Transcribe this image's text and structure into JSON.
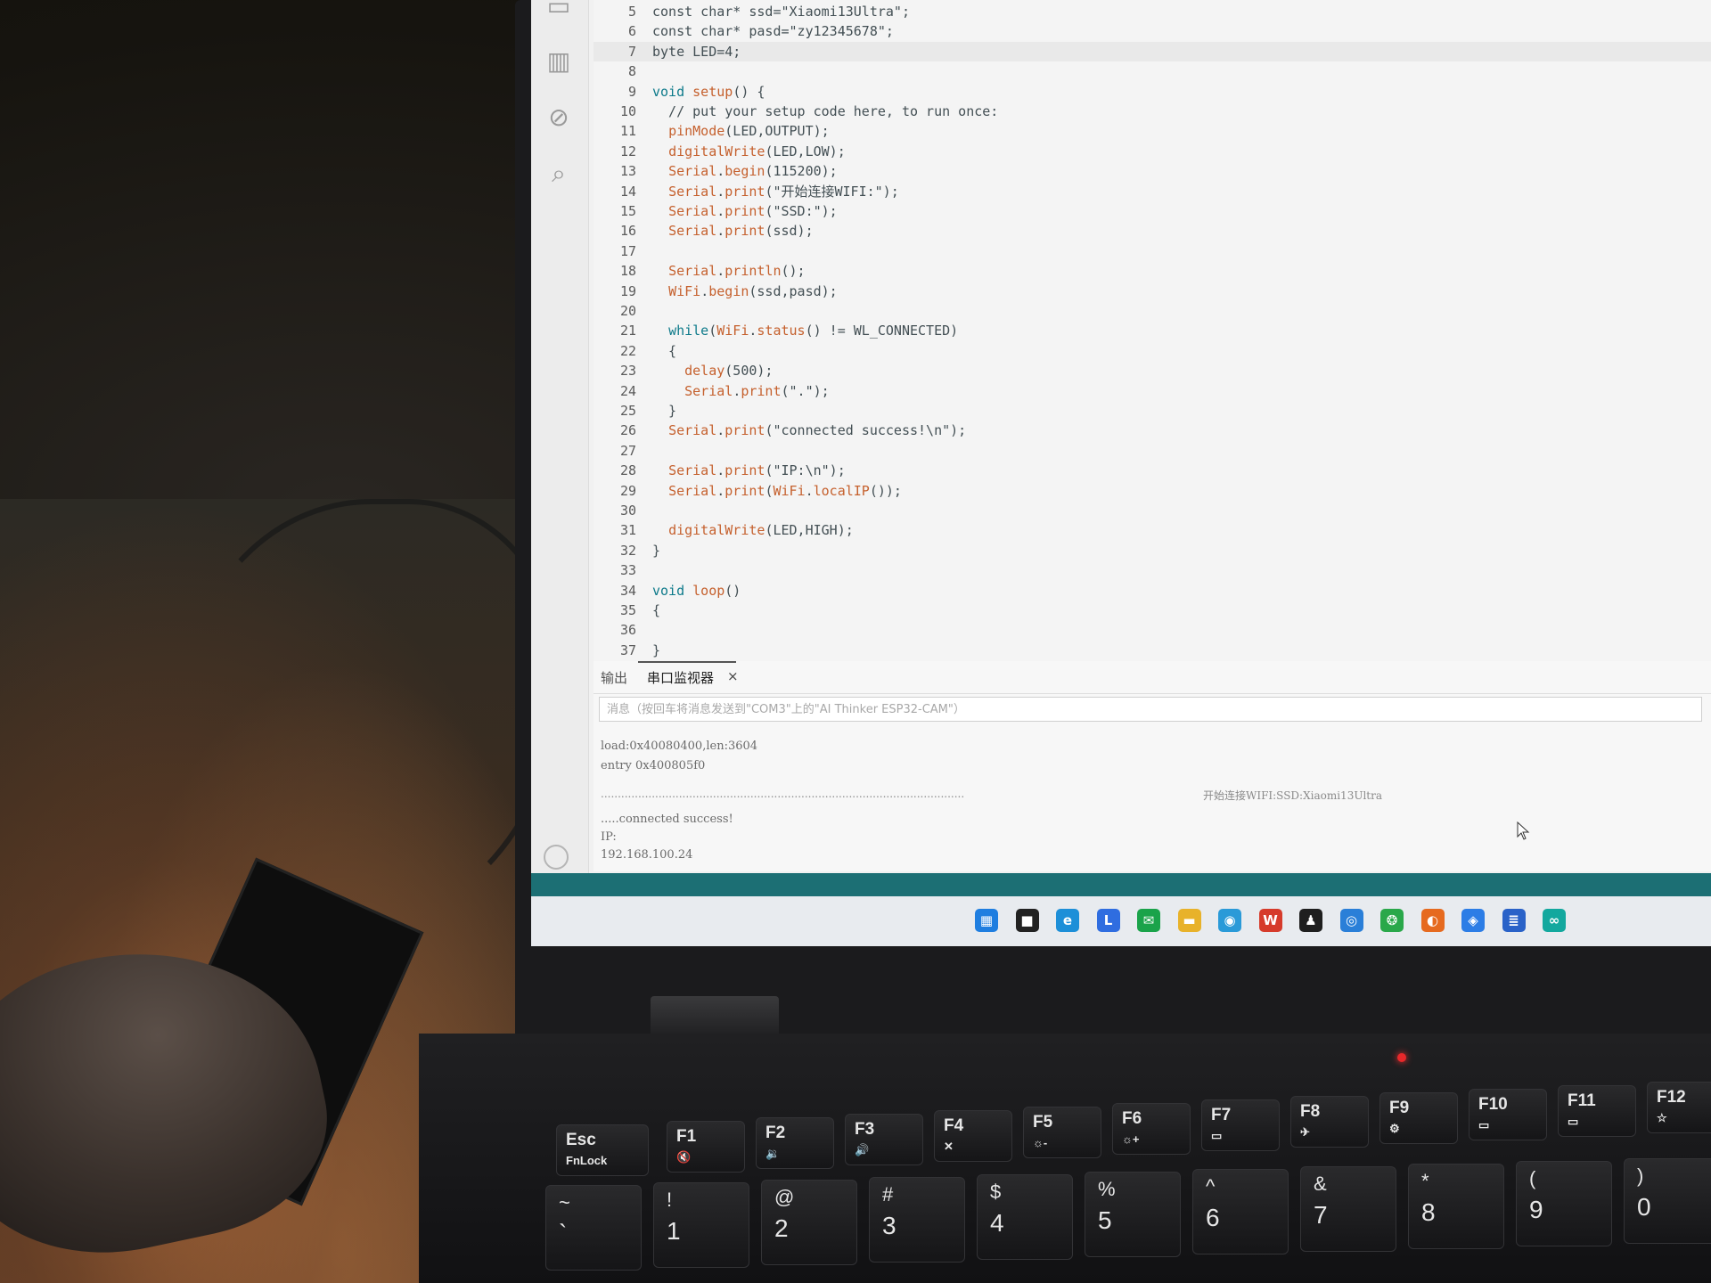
{
  "editor": {
    "current_line_index": 2,
    "lines": [
      {
        "num": "5",
        "segments": [
          {
            "t": "const char* ssd=\"Xiaomi13Ultra\";",
            "c": ""
          }
        ]
      },
      {
        "num": "6",
        "segments": [
          {
            "t": "const char* pasd=\"zy12345678\";",
            "c": ""
          }
        ]
      },
      {
        "num": "7",
        "segments": [
          {
            "t": "byte LED=4;",
            "c": ""
          }
        ]
      },
      {
        "num": "8",
        "segments": []
      },
      {
        "num": "9",
        "segments": [
          {
            "t": "void ",
            "c": "kw"
          },
          {
            "t": "setup",
            "c": "fn"
          },
          {
            "t": "() {",
            "c": ""
          }
        ]
      },
      {
        "num": "10",
        "segments": [
          {
            "t": "  // put your setup code here, to run once:",
            "c": ""
          }
        ]
      },
      {
        "num": "11",
        "segments": [
          {
            "t": "  ",
            "c": ""
          },
          {
            "t": "pinMode",
            "c": "fn"
          },
          {
            "t": "(LED,OUTPUT);",
            "c": ""
          }
        ]
      },
      {
        "num": "12",
        "segments": [
          {
            "t": "  ",
            "c": ""
          },
          {
            "t": "digitalWrite",
            "c": "fn"
          },
          {
            "t": "(LED,LOW);",
            "c": ""
          }
        ]
      },
      {
        "num": "13",
        "segments": [
          {
            "t": "  ",
            "c": ""
          },
          {
            "t": "Serial",
            "c": "fn"
          },
          {
            "t": ".",
            "c": ""
          },
          {
            "t": "begin",
            "c": "fn"
          },
          {
            "t": "(115200);",
            "c": ""
          }
        ]
      },
      {
        "num": "14",
        "segments": [
          {
            "t": "  ",
            "c": ""
          },
          {
            "t": "Serial",
            "c": "fn"
          },
          {
            "t": ".",
            "c": ""
          },
          {
            "t": "print",
            "c": "fn"
          },
          {
            "t": "(\"开始连接WIFI:\");",
            "c": ""
          }
        ]
      },
      {
        "num": "15",
        "segments": [
          {
            "t": "  ",
            "c": ""
          },
          {
            "t": "Serial",
            "c": "fn"
          },
          {
            "t": ".",
            "c": ""
          },
          {
            "t": "print",
            "c": "fn"
          },
          {
            "t": "(\"SSD:\");",
            "c": ""
          }
        ]
      },
      {
        "num": "16",
        "segments": [
          {
            "t": "  ",
            "c": ""
          },
          {
            "t": "Serial",
            "c": "fn"
          },
          {
            "t": ".",
            "c": ""
          },
          {
            "t": "print",
            "c": "fn"
          },
          {
            "t": "(ssd);",
            "c": ""
          }
        ]
      },
      {
        "num": "17",
        "segments": []
      },
      {
        "num": "18",
        "segments": [
          {
            "t": "  ",
            "c": ""
          },
          {
            "t": "Serial",
            "c": "fn"
          },
          {
            "t": ".",
            "c": ""
          },
          {
            "t": "println",
            "c": "fn"
          },
          {
            "t": "();",
            "c": ""
          }
        ]
      },
      {
        "num": "19",
        "segments": [
          {
            "t": "  ",
            "c": ""
          },
          {
            "t": "WiFi",
            "c": "fn"
          },
          {
            "t": ".",
            "c": ""
          },
          {
            "t": "begin",
            "c": "fn"
          },
          {
            "t": "(ssd,pasd);",
            "c": ""
          }
        ]
      },
      {
        "num": "20",
        "segments": []
      },
      {
        "num": "21",
        "segments": [
          {
            "t": "  ",
            "c": ""
          },
          {
            "t": "while",
            "c": "kw"
          },
          {
            "t": "(",
            "c": ""
          },
          {
            "t": "WiFi",
            "c": "fn"
          },
          {
            "t": ".",
            "c": ""
          },
          {
            "t": "status",
            "c": "fn"
          },
          {
            "t": "() != WL_CONNECTED)",
            "c": ""
          }
        ]
      },
      {
        "num": "22",
        "segments": [
          {
            "t": "  {",
            "c": ""
          }
        ]
      },
      {
        "num": "23",
        "segments": [
          {
            "t": "    ",
            "c": ""
          },
          {
            "t": "delay",
            "c": "fn"
          },
          {
            "t": "(500);",
            "c": ""
          }
        ]
      },
      {
        "num": "24",
        "segments": [
          {
            "t": "    ",
            "c": ""
          },
          {
            "t": "Serial",
            "c": "fn"
          },
          {
            "t": ".",
            "c": ""
          },
          {
            "t": "print",
            "c": "fn"
          },
          {
            "t": "(\".\");",
            "c": ""
          }
        ]
      },
      {
        "num": "25",
        "segments": [
          {
            "t": "  }",
            "c": ""
          }
        ]
      },
      {
        "num": "26",
        "segments": [
          {
            "t": "  ",
            "c": ""
          },
          {
            "t": "Serial",
            "c": "fn"
          },
          {
            "t": ".",
            "c": ""
          },
          {
            "t": "print",
            "c": "fn"
          },
          {
            "t": "(\"connected success!\\n\");",
            "c": ""
          }
        ]
      },
      {
        "num": "27",
        "segments": []
      },
      {
        "num": "28",
        "segments": [
          {
            "t": "  ",
            "c": ""
          },
          {
            "t": "Serial",
            "c": "fn"
          },
          {
            "t": ".",
            "c": ""
          },
          {
            "t": "print",
            "c": "fn"
          },
          {
            "t": "(\"IP:\\n\");",
            "c": ""
          }
        ]
      },
      {
        "num": "29",
        "segments": [
          {
            "t": "  ",
            "c": ""
          },
          {
            "t": "Serial",
            "c": "fn"
          },
          {
            "t": ".",
            "c": ""
          },
          {
            "t": "print",
            "c": "fn"
          },
          {
            "t": "(",
            "c": ""
          },
          {
            "t": "WiFi",
            "c": "fn"
          },
          {
            "t": ".",
            "c": ""
          },
          {
            "t": "localIP",
            "c": "fn"
          },
          {
            "t": "());",
            "c": ""
          }
        ]
      },
      {
        "num": "30",
        "segments": []
      },
      {
        "num": "31",
        "segments": [
          {
            "t": "  ",
            "c": ""
          },
          {
            "t": "digitalWrite",
            "c": "fn"
          },
          {
            "t": "(LED,HIGH);",
            "c": ""
          }
        ]
      },
      {
        "num": "32",
        "segments": [
          {
            "t": "}",
            "c": ""
          }
        ]
      },
      {
        "num": "33",
        "segments": []
      },
      {
        "num": "34",
        "segments": [
          {
            "t": "void ",
            "c": "kw"
          },
          {
            "t": "loop",
            "c": "fn"
          },
          {
            "t": "()",
            "c": ""
          }
        ]
      },
      {
        "num": "35",
        "segments": [
          {
            "t": "{",
            "c": ""
          }
        ]
      },
      {
        "num": "36",
        "segments": []
      },
      {
        "num": "37",
        "segments": [
          {
            "t": "}",
            "c": ""
          }
        ]
      }
    ]
  },
  "side_rail": {
    "icons": [
      "board-manager-icon",
      "library-icon",
      "debug-icon",
      "search-icon"
    ],
    "user_icon": "account-icon"
  },
  "panel": {
    "tab_output": "输出",
    "tab_serial": "串口监视器",
    "tab_close": "×",
    "message_placeholder": "消息（按回车将消息发送到\"COM3\"上的\"AI Thinker ESP32-CAM\"）",
    "serial_lines": {
      "load": "load:0x40080400,len:3604",
      "entry": "entry 0x400805f0",
      "dots": "...........................................................................................................",
      "wifi_tail": "开始连接WIFI:SSD:Xiaomi13Ultra",
      "connected": ".....connected success!",
      "ip_label": "IP:",
      "ip_value": "192.168.100.24"
    }
  },
  "taskbar": {
    "icons": [
      {
        "name": "windows-start-icon",
        "glyph": "▦",
        "color": "#1f7ee0"
      },
      {
        "name": "task-view-icon",
        "glyph": "■",
        "color": "#222222"
      },
      {
        "name": "edge-browser-icon",
        "glyph": "e",
        "color": "#1d8fd8"
      },
      {
        "name": "app-blue-icon",
        "glyph": "L",
        "color": "#2f6de0"
      },
      {
        "name": "wechat-mail-icon",
        "glyph": "✉",
        "color": "#1aa34a"
      },
      {
        "name": "file-explorer-icon",
        "glyph": "▬",
        "color": "#e8b22a"
      },
      {
        "name": "browser-icon",
        "glyph": "◉",
        "color": "#2a9ad8"
      },
      {
        "name": "wps-office-icon",
        "glyph": "W",
        "color": "#d63b2b"
      },
      {
        "name": "qq-icon",
        "glyph": "♟",
        "color": "#1f1f1f"
      },
      {
        "name": "search-app-icon",
        "glyph": "◎",
        "color": "#2a7fd8"
      },
      {
        "name": "wechat-icon",
        "glyph": "❂",
        "color": "#2aa84a"
      },
      {
        "name": "firefox-icon",
        "glyph": "◐",
        "color": "#e66a1f"
      },
      {
        "name": "store-icon",
        "glyph": "◈",
        "color": "#2c7de6"
      },
      {
        "name": "notepad-icon",
        "glyph": "≣",
        "color": "#2a62c8"
      },
      {
        "name": "arduino-ide-icon",
        "glyph": "∞",
        "color": "#13a89e"
      }
    ]
  },
  "keyboard": {
    "fn_row": [
      {
        "main": "Esc",
        "sub": "FnLock"
      },
      {
        "main": "F1",
        "sub": "🔇"
      },
      {
        "main": "F2",
        "sub": "🔉"
      },
      {
        "main": "F3",
        "sub": "🔊"
      },
      {
        "main": "F4",
        "sub": "✕"
      },
      {
        "main": "F5",
        "sub": "☼-"
      },
      {
        "main": "F6",
        "sub": "☼+"
      },
      {
        "main": "F7",
        "sub": "▭"
      },
      {
        "main": "F8",
        "sub": "✈"
      },
      {
        "main": "F9",
        "sub": "⚙"
      },
      {
        "main": "F10",
        "sub": "▭"
      },
      {
        "main": "F11",
        "sub": "▭"
      },
      {
        "main": "F12",
        "sub": "☆"
      }
    ],
    "num_row": [
      {
        "sym": "~",
        "num": "`"
      },
      {
        "sym": "!",
        "num": "1"
      },
      {
        "sym": "@",
        "num": "2"
      },
      {
        "sym": "#",
        "num": "3"
      },
      {
        "sym": "$",
        "num": "4"
      },
      {
        "sym": "%",
        "num": "5"
      },
      {
        "sym": "^",
        "num": "6"
      },
      {
        "sym": "&",
        "num": "7"
      },
      {
        "sym": "*",
        "num": "8"
      },
      {
        "sym": "(",
        "num": "9"
      },
      {
        "sym": ")",
        "num": "0"
      }
    ]
  }
}
